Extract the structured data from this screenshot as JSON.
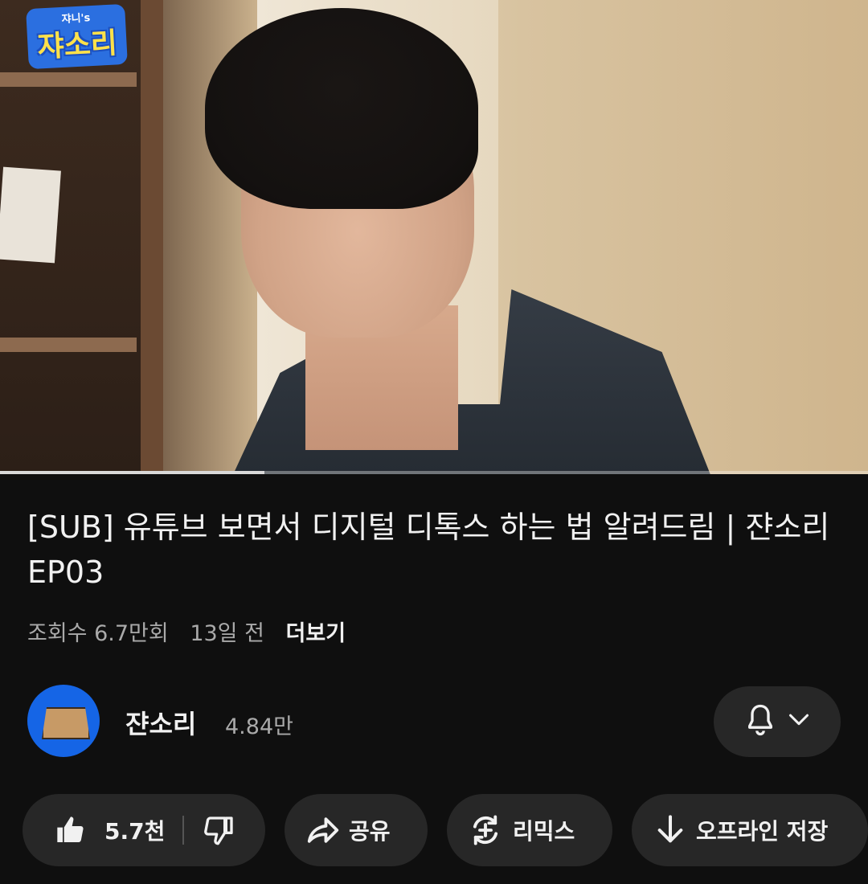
{
  "video": {
    "logo_small": "쟈니's",
    "logo_text": "쟈소리",
    "progress_fraction": 0.305
  },
  "title": "[SUB] 유튜브 보면서 디지털 디톡스 하는 법 알려드림 | 쟌소리 EP03",
  "meta": {
    "views": "조회수 6.7만회",
    "age": "13일 전",
    "more": "더보기"
  },
  "channel": {
    "name": "쟌소리",
    "subscribers": "4.84만"
  },
  "actions": {
    "like_count": "5.7천",
    "share": "공유",
    "remix": "리믹스",
    "download": "오프라인 저장"
  },
  "icons": {
    "like": "thumbs-up-icon",
    "dislike": "thumbs-down-icon",
    "share": "share-arrow-icon",
    "remix": "remix-icon",
    "download": "download-arrow-icon",
    "bell": "bell-icon",
    "chevron": "chevron-down-icon"
  },
  "colors": {
    "background": "#0f0f0f",
    "pill": "#272727",
    "secondary_text": "#aaaaaa",
    "avatar_bg": "#1565e6"
  }
}
